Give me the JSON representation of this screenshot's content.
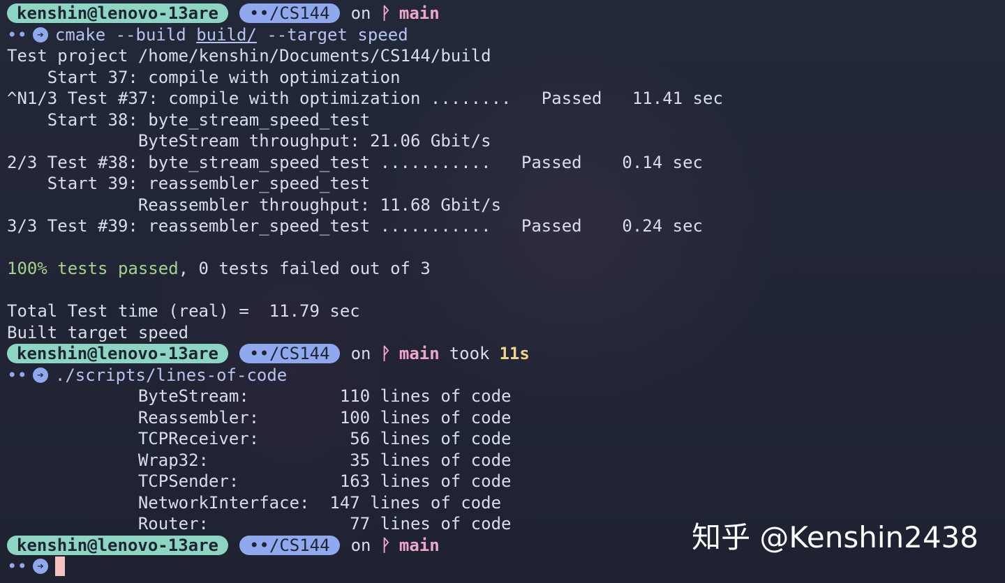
{
  "prompt": {
    "user_host": "kenshin@lenovo-13are",
    "dir": "••/CS144",
    "on_word": "on",
    "branch_icon": "ᚹ",
    "branch": "main",
    "took_word": "took",
    "took_value": "11s",
    "dots": "••",
    "arrow_icon": "➔"
  },
  "block1": {
    "cmd_prefix": "cmake --build ",
    "cmd_path": "build/",
    "cmd_suffix": " --target speed",
    "output": [
      "Test project /home/kenshin/Documents/CS144/build",
      "    Start 37: compile with optimization",
      "^N1/3 Test #37: compile with optimization ........   Passed   11.41 sec",
      "    Start 38: byte_stream_speed_test",
      "             ByteStream throughput: 21.06 Gbit/s",
      "2/3 Test #38: byte_stream_speed_test ...........   Passed    0.14 sec",
      "    Start 39: reassembler_speed_test",
      "             Reassembler throughput: 11.68 Gbit/s",
      "3/3 Test #39: reassembler_speed_test ...........   Passed    0.24 sec",
      "",
      "",
      "",
      "Total Test time (real) =  11.79 sec",
      "Built target speed"
    ],
    "summary_green": "100% tests passed",
    "summary_rest": ", 0 tests failed out of 3"
  },
  "block2": {
    "cmd": "./scripts/lines-of-code",
    "output": [
      "             ByteStream:         110 lines of code",
      "             Reassembler:        100 lines of code",
      "             TCPReceiver:         56 lines of code",
      "             Wrap32:              35 lines of code",
      "             TCPSender:          163 lines of code",
      "             NetworkInterface:  147 lines of code",
      "             Router:              77 lines of code"
    ]
  },
  "watermark": "知乎 @Kenshin2438",
  "colors": {
    "background": "#1f2433",
    "user_segment": "#8bd5c2",
    "dir_segment": "#8fa8ee",
    "branch": "#f0a6c8",
    "took_value": "#f2d28a",
    "success": "#a6d189",
    "cursor": "#f5c2c0"
  }
}
